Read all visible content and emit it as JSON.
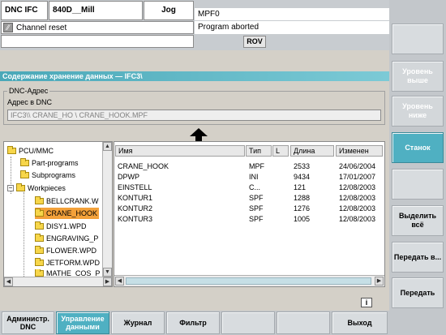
{
  "header": {
    "dnc": "DNC IFC",
    "mill": "840D__Mill",
    "mode": "Jog",
    "program": "MPF0",
    "channel_status": "Channel reset",
    "program_status": "Program aborted",
    "rov": "ROV"
  },
  "title": "Содержание хранение данных — IFC3\\",
  "address": {
    "group_label": "DNC-Адрес",
    "label": "Адрес в DNC",
    "value": "IFC3\\\\ CRANE_HO \\ CRANE_HOOK.MPF"
  },
  "tree": {
    "items": [
      {
        "label": "PCU/MMC",
        "icon": "folder-icon"
      },
      {
        "label": "Part-programs",
        "icon": "folder-icon"
      },
      {
        "label": "Subprograms",
        "icon": "folder-icon"
      },
      {
        "label": "Workpieces",
        "icon": "folder-icon"
      },
      {
        "label": "BELLCRANK.W",
        "icon": "folder-icon"
      },
      {
        "label": "CRANE_HOOK",
        "icon": "folder-open-icon",
        "selected": true
      },
      {
        "label": "DISY1.WPD",
        "icon": "folder-icon"
      },
      {
        "label": "ENGRAVING_P",
        "icon": "folder-icon"
      },
      {
        "label": "FLOWER.WPD",
        "icon": "folder-icon"
      },
      {
        "label": "JETFORM.WPD",
        "icon": "folder-icon"
      },
      {
        "label": "MATHE_COS_P",
        "icon": "folder-icon"
      }
    ]
  },
  "files": {
    "columns": [
      "Имя",
      "Тип",
      "L",
      "Длина",
      "Изменен"
    ],
    "rows": [
      [
        "CRANE_HOOK",
        "MPF",
        "",
        "2533",
        "24/06/2004"
      ],
      [
        "DPWP",
        "INI",
        "",
        "9434",
        "17/01/2007"
      ],
      [
        "EINSTELL",
        "C...",
        "",
        "121",
        "12/08/2003"
      ],
      [
        "KONTUR1",
        "SPF",
        "",
        "1288",
        "12/08/2003"
      ],
      [
        "KONTUR2",
        "SPF",
        "",
        "1276",
        "12/08/2003"
      ],
      [
        "KONTUR3",
        "SPF",
        "",
        "1005",
        "12/08/2003"
      ]
    ]
  },
  "info_label": "i",
  "vertical_softkeys": {
    "sk1": "",
    "sk2": "",
    "sk3": "Уровень выше",
    "sk4": "Уровень ниже",
    "sk5": "Станок",
    "sk6": "",
    "sk7": "Выделить всё",
    "sk8": "Передать в...",
    "sk9": "Передать"
  },
  "horizontal_softkeys": {
    "hk1": "Администр. DNC",
    "hk2": "Управление данными",
    "hk3": "Журнал",
    "hk4": "Фильтр",
    "hk5": "",
    "hk6": "",
    "hk7": "Выход"
  },
  "colors": {
    "accent": "#4fb0c2",
    "selection": "#f3a13a",
    "title_bar": "#4aa8b8"
  }
}
